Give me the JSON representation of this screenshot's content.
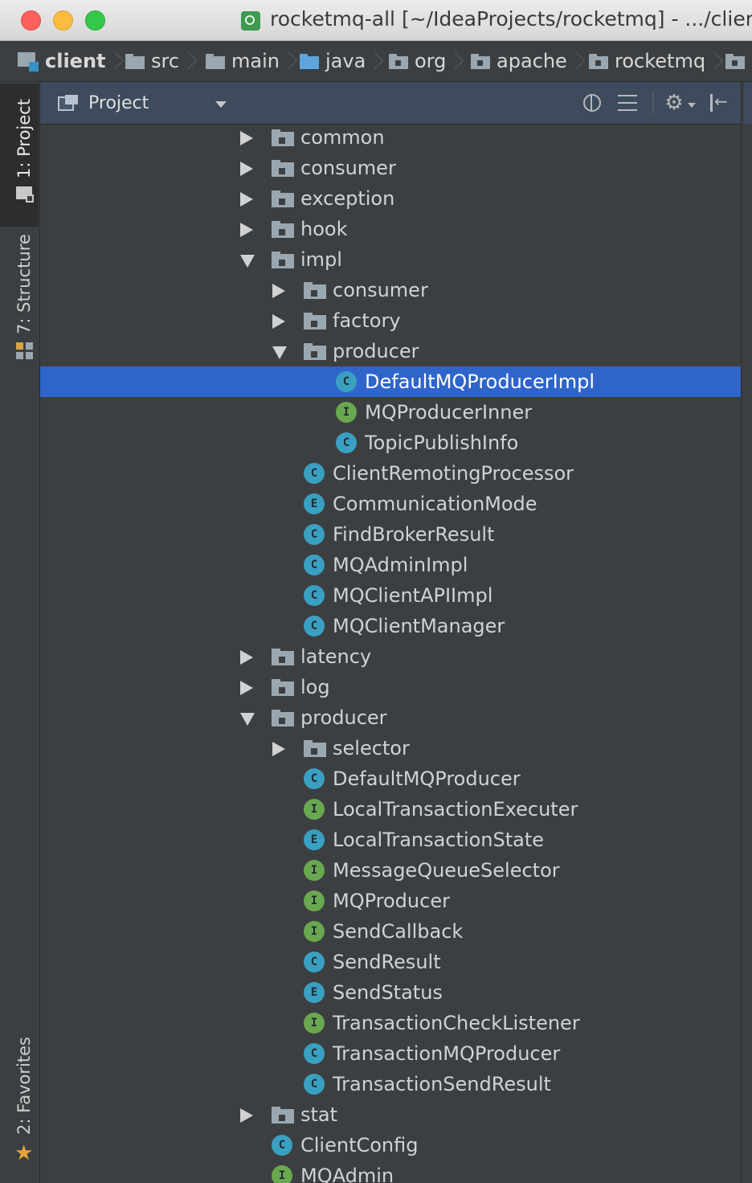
{
  "window": {
    "title": "rocketmq-all [~/IdeaProjects/rocketmq] - .../client"
  },
  "breadcrumb": [
    {
      "label": "client",
      "icon": "module-icon",
      "bold": true
    },
    {
      "label": "src",
      "icon": "folder-icon"
    },
    {
      "label": "main",
      "icon": "folder-icon"
    },
    {
      "label": "java",
      "icon": "source-folder-icon"
    },
    {
      "label": "org",
      "icon": "package-icon"
    },
    {
      "label": "apache",
      "icon": "package-icon"
    },
    {
      "label": "rocketmq",
      "icon": "package-icon"
    },
    {
      "label": "",
      "icon": "package-icon"
    }
  ],
  "tool_stripe": {
    "project_tab": "1: Project",
    "structure_tab": "7: Structure",
    "favorites_tab": "2: Favorites"
  },
  "panel": {
    "title": "Project",
    "buttons": [
      "locate-icon",
      "collapse-all-icon",
      "gear-icon",
      "hide-icon"
    ]
  },
  "colors": {
    "selection": "#2f65ca",
    "class_badge": "#3aa0c2",
    "interface_badge": "#6aa84f",
    "enum_badge": "#3aa0c2",
    "folder": "#9aa7b0"
  },
  "tree": [
    {
      "label": "common",
      "type": "package",
      "depth": 0,
      "state": "collapsed"
    },
    {
      "label": "consumer",
      "type": "package",
      "depth": 0,
      "state": "collapsed"
    },
    {
      "label": "exception",
      "type": "package",
      "depth": 0,
      "state": "collapsed"
    },
    {
      "label": "hook",
      "type": "package",
      "depth": 0,
      "state": "collapsed"
    },
    {
      "label": "impl",
      "type": "package",
      "depth": 0,
      "state": "expanded"
    },
    {
      "label": "consumer",
      "type": "package",
      "depth": 1,
      "state": "collapsed"
    },
    {
      "label": "factory",
      "type": "package",
      "depth": 1,
      "state": "collapsed"
    },
    {
      "label": "producer",
      "type": "package",
      "depth": 1,
      "state": "expanded"
    },
    {
      "label": "DefaultMQProducerImpl",
      "type": "class",
      "badge": "C",
      "depth": 2,
      "selected": true
    },
    {
      "label": "MQProducerInner",
      "type": "interface",
      "badge": "I",
      "depth": 2
    },
    {
      "label": "TopicPublishInfo",
      "type": "class",
      "badge": "C",
      "depth": 2
    },
    {
      "label": "ClientRemotingProcessor",
      "type": "class",
      "badge": "C",
      "depth": 1
    },
    {
      "label": "CommunicationMode",
      "type": "enum",
      "badge": "E",
      "depth": 1
    },
    {
      "label": "FindBrokerResult",
      "type": "class",
      "badge": "C",
      "depth": 1
    },
    {
      "label": "MQAdminImpl",
      "type": "class",
      "badge": "C",
      "depth": 1
    },
    {
      "label": "MQClientAPIImpl",
      "type": "class",
      "badge": "C",
      "depth": 1
    },
    {
      "label": "MQClientManager",
      "type": "class",
      "badge": "C",
      "depth": 1
    },
    {
      "label": "latency",
      "type": "package",
      "depth": 0,
      "state": "collapsed"
    },
    {
      "label": "log",
      "type": "package",
      "depth": 0,
      "state": "collapsed"
    },
    {
      "label": "producer",
      "type": "package",
      "depth": 0,
      "state": "expanded"
    },
    {
      "label": "selector",
      "type": "package",
      "depth": 1,
      "state": "collapsed"
    },
    {
      "label": "DefaultMQProducer",
      "type": "class",
      "badge": "C",
      "depth": 1
    },
    {
      "label": "LocalTransactionExecuter",
      "type": "interface",
      "badge": "I",
      "depth": 1
    },
    {
      "label": "LocalTransactionState",
      "type": "enum",
      "badge": "E",
      "depth": 1
    },
    {
      "label": "MessageQueueSelector",
      "type": "interface",
      "badge": "I",
      "depth": 1
    },
    {
      "label": "MQProducer",
      "type": "interface",
      "badge": "I",
      "depth": 1
    },
    {
      "label": "SendCallback",
      "type": "interface",
      "badge": "I",
      "depth": 1
    },
    {
      "label": "SendResult",
      "type": "class",
      "badge": "C",
      "depth": 1
    },
    {
      "label": "SendStatus",
      "type": "enum",
      "badge": "E",
      "depth": 1
    },
    {
      "label": "TransactionCheckListener",
      "type": "interface",
      "badge": "I",
      "depth": 1
    },
    {
      "label": "TransactionMQProducer",
      "type": "class",
      "badge": "C",
      "depth": 1
    },
    {
      "label": "TransactionSendResult",
      "type": "class",
      "badge": "C",
      "depth": 1
    },
    {
      "label": "stat",
      "type": "package",
      "depth": 0,
      "state": "collapsed"
    },
    {
      "label": "ClientConfig",
      "type": "class",
      "badge": "C",
      "depth": 0
    },
    {
      "label": "MQAdmin",
      "type": "interface",
      "badge": "I",
      "depth": 0
    }
  ]
}
